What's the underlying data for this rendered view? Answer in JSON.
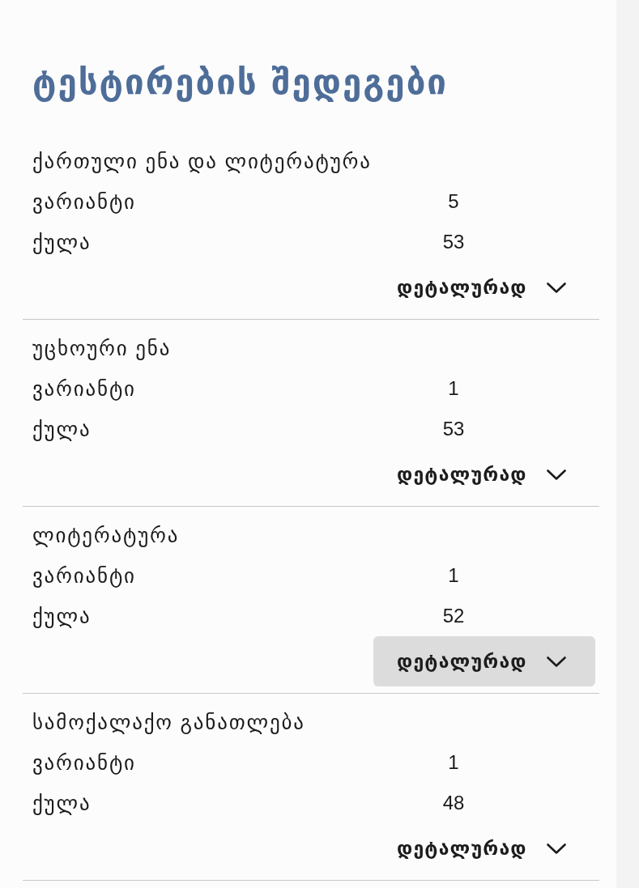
{
  "title": "ტესტირების შედეგები",
  "subjects": [
    {
      "name": "ქართული ენა და ლიტერატურა",
      "rows": [
        {
          "label": "ვარიანტი",
          "value": "5"
        },
        {
          "label": "ქულა",
          "value": "53"
        }
      ],
      "details_button": {
        "label": "დეტალურად",
        "highlighted": false,
        "expanded": false
      }
    },
    {
      "name": "უცხოური ენა",
      "rows": [
        {
          "label": "ვარიანტი",
          "value": "1"
        },
        {
          "label": "ქულა",
          "value": "53"
        }
      ],
      "details_button": {
        "label": "დეტალურად",
        "highlighted": false,
        "expanded": false
      }
    },
    {
      "name": "ლიტერატურა",
      "rows": [
        {
          "label": "ვარიანტი",
          "value": "1"
        },
        {
          "label": "ქულა",
          "value": "52"
        }
      ],
      "details_button": {
        "label": "დეტალურად",
        "highlighted": true,
        "expanded": false
      }
    },
    {
      "name": "სამოქალაქო განათლება",
      "rows": [
        {
          "label": "ვარიანტი",
          "value": "1"
        },
        {
          "label": "ქულა",
          "value": "48"
        }
      ],
      "details_button": {
        "label": "დეტალურად",
        "highlighted": false,
        "expanded": false
      }
    }
  ]
}
